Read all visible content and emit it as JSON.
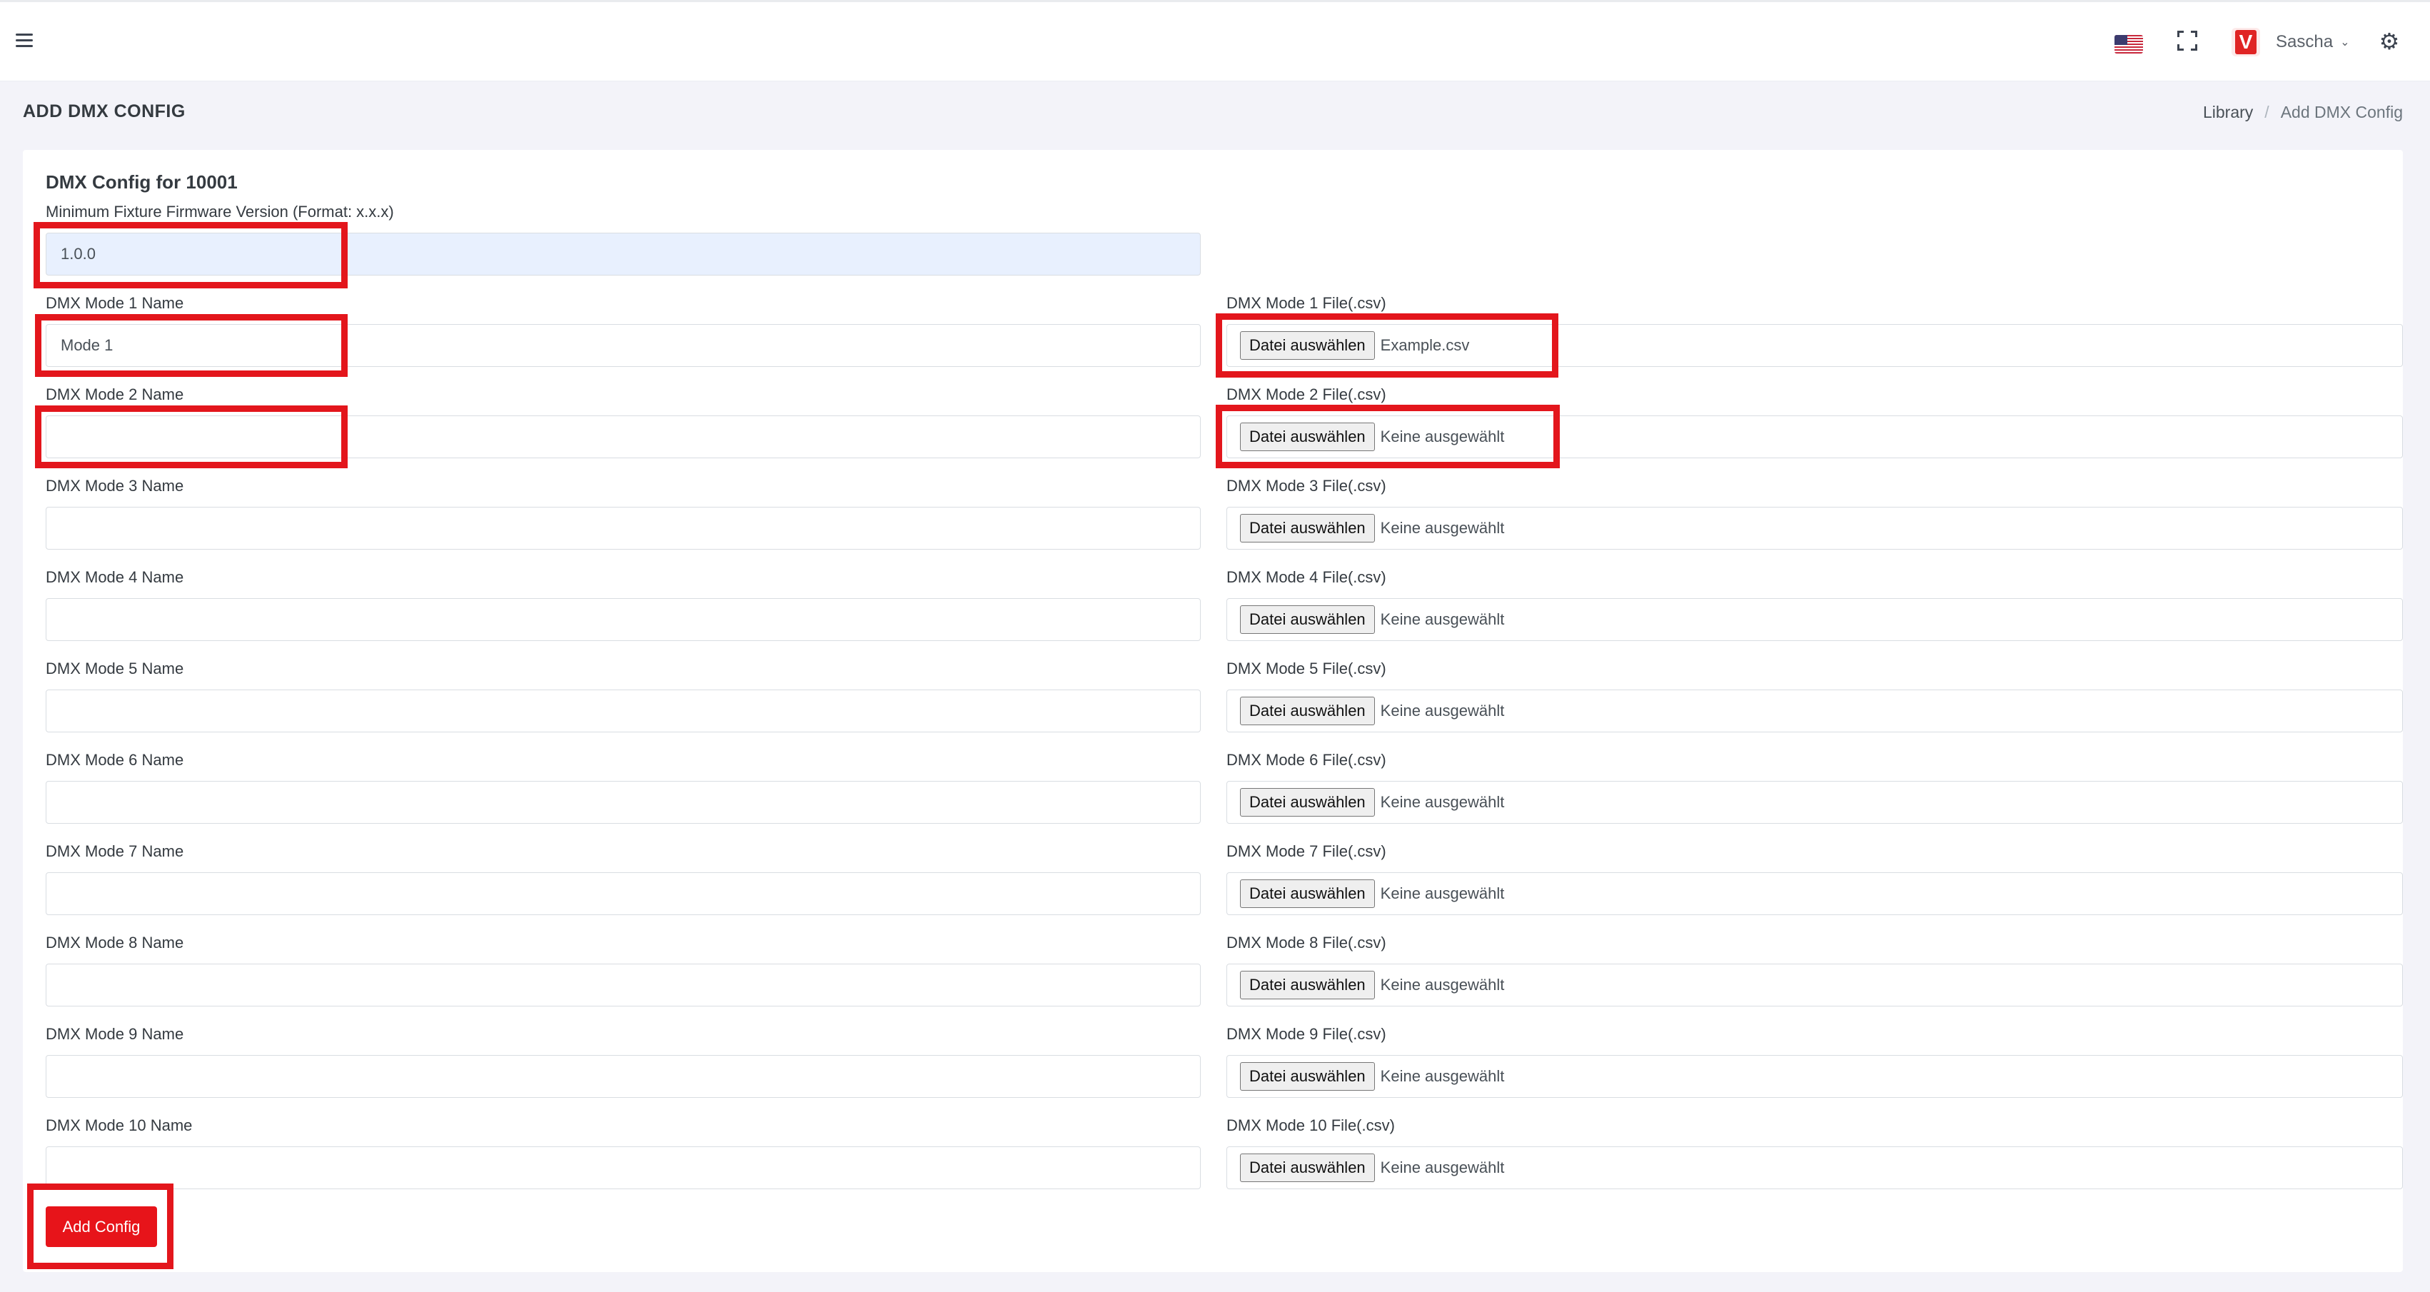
{
  "header": {
    "menu_icon": "hamburger-icon",
    "flag_icon": "us-flag-icon",
    "fullscreen_icon": "fullscreen-icon",
    "avatar_letter": "V",
    "user_name": "Sascha",
    "dropdown_icon": "chevron-down-icon",
    "settings_icon": "gear-icon"
  },
  "page": {
    "title": "ADD DMX CONFIG",
    "breadcrumb": [
      "Library",
      "/",
      "Add DMX Config"
    ]
  },
  "form": {
    "title": "DMX Config for 10001",
    "firmware_label": "Minimum Fixture Firmware Version (Format: x.x.x)",
    "firmware_value": "1.0.0",
    "file_button_label": "Datei auswählen",
    "modes": [
      {
        "name_label": "DMX Mode 1 Name",
        "name_value": "Mode 1",
        "file_label": "DMX Mode 1 File(.csv)",
        "file_value": "Example.csv"
      },
      {
        "name_label": "DMX Mode 2 Name",
        "name_value": "",
        "file_label": "DMX Mode 2 File(.csv)",
        "file_value": "Keine ausgewählt"
      },
      {
        "name_label": "DMX Mode 3 Name",
        "name_value": "",
        "file_label": "DMX Mode 3 File(.csv)",
        "file_value": "Keine ausgewählt"
      },
      {
        "name_label": "DMX Mode 4 Name",
        "name_value": "",
        "file_label": "DMX Mode 4 File(.csv)",
        "file_value": "Keine ausgewählt"
      },
      {
        "name_label": "DMX Mode 5 Name",
        "name_value": "",
        "file_label": "DMX Mode 5 File(.csv)",
        "file_value": "Keine ausgewählt"
      },
      {
        "name_label": "DMX Mode 6 Name",
        "name_value": "",
        "file_label": "DMX Mode 6 File(.csv)",
        "file_value": "Keine ausgewählt"
      },
      {
        "name_label": "DMX Mode 7 Name",
        "name_value": "",
        "file_label": "DMX Mode 7 File(.csv)",
        "file_value": "Keine ausgewählt"
      },
      {
        "name_label": "DMX Mode 8 Name",
        "name_value": "",
        "file_label": "DMX Mode 8 File(.csv)",
        "file_value": "Keine ausgewählt"
      },
      {
        "name_label": "DMX Mode 9 Name",
        "name_value": "",
        "file_label": "DMX Mode 9 File(.csv)",
        "file_value": "Keine ausgewählt"
      },
      {
        "name_label": "DMX Mode 10 Name",
        "name_value": "",
        "file_label": "DMX Mode 10 File(.csv)",
        "file_value": "Keine ausgewählt"
      }
    ],
    "submit_label": "Add Config"
  },
  "colors": {
    "accent": "#e7141a",
    "highlight": "#e3161c",
    "autofill_background": "#e8f0fe",
    "page_background": "#f3f3f9"
  }
}
